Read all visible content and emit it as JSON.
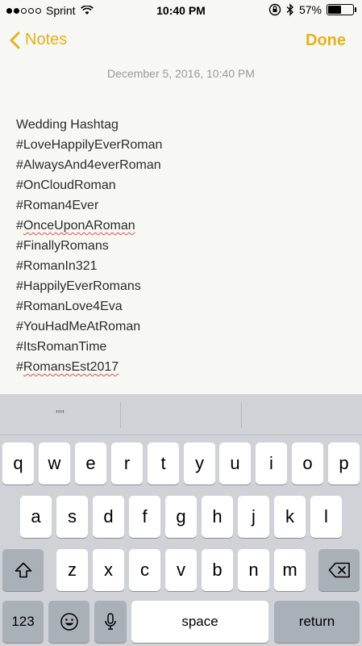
{
  "status_bar": {
    "carrier": "Sprint",
    "time": "10:40 PM",
    "battery_percent": "57%",
    "battery_level": 0.57,
    "signal_bars": 2
  },
  "nav": {
    "back_label": "Notes",
    "done_label": "Done"
  },
  "note": {
    "date": "December 5, 2016, 10:40 PM",
    "lines": [
      "Wedding Hashtag",
      "#LoveHappilyEverRoman",
      "#AlwaysAnd4everRoman",
      "#OnCloudRoman",
      "#Roman4Ever",
      "#OnceUponARoman",
      "#FinallyRomans",
      "#RomanIn321",
      "#HappilyEverRomans",
      "#RomanLove4Eva",
      "#YouHadMeAtRoman",
      "#ItsRomanTime",
      "#RomansEst2017"
    ],
    "line5_prefix": "#",
    "line5_word": "OnceUponARoman",
    "line12_prefix": "#",
    "line12_word": "RomansEst2017"
  },
  "keyboard": {
    "predictive": [
      "\"\"",
      "",
      ""
    ],
    "row1": [
      "q",
      "w",
      "e",
      "r",
      "t",
      "y",
      "u",
      "i",
      "o",
      "p"
    ],
    "row2": [
      "a",
      "s",
      "d",
      "f",
      "g",
      "h",
      "j",
      "k",
      "l"
    ],
    "row3": [
      "z",
      "x",
      "c",
      "v",
      "b",
      "n",
      "m"
    ],
    "numbers_label": "123",
    "space_label": "space",
    "return_label": "return"
  }
}
